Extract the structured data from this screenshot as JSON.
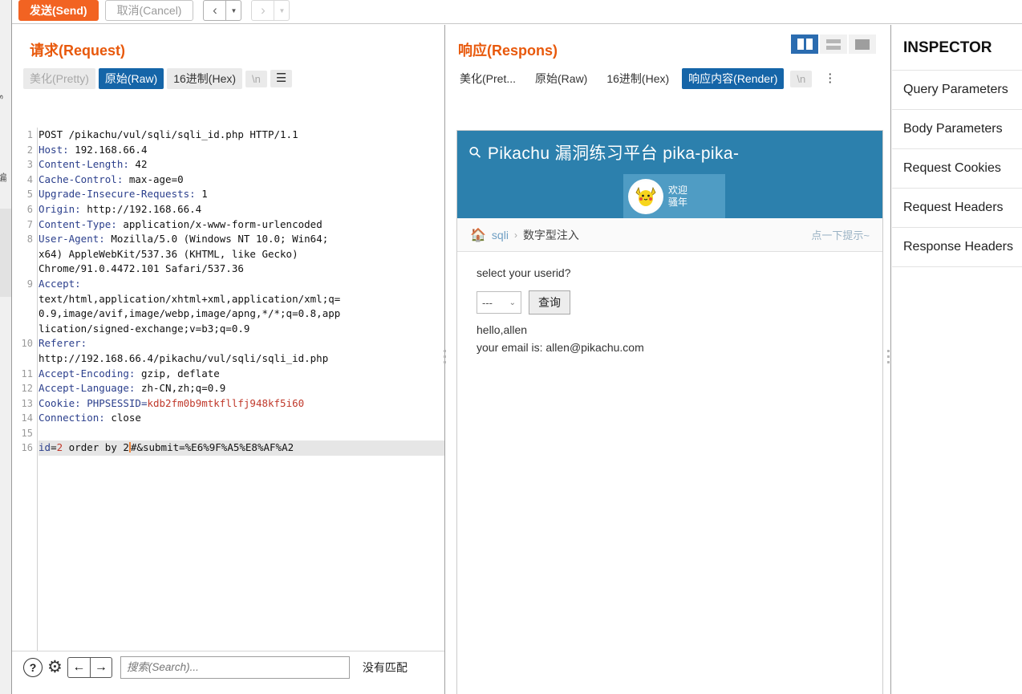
{
  "toolbar": {
    "send_label": "发送(Send)",
    "cancel_label": "取消(Cancel)",
    "prev_icon": "‹",
    "prev_caret": "▼",
    "next_icon": "›",
    "next_caret": "▼"
  },
  "request": {
    "title": "请求(Request)",
    "tabs": [
      {
        "label": "美化(Pretty)",
        "state": "muted"
      },
      {
        "label": "原始(Raw)",
        "state": "active"
      },
      {
        "label": "16进制(Hex)",
        "state": "normal"
      }
    ],
    "newline_label": "\\n",
    "menu_icon": "☰",
    "lines": [
      {
        "n": "1",
        "type": "plain",
        "text": "POST /pikachu/vul/sqli/sqli_id.php HTTP/1.1"
      },
      {
        "n": "2",
        "type": "hdr",
        "name": "Host:",
        "value": " 192.168.66.4"
      },
      {
        "n": "3",
        "type": "hdr",
        "name": "Content-Length:",
        "value": " 42"
      },
      {
        "n": "4",
        "type": "hdr",
        "name": "Cache-Control:",
        "value": " max-age=0"
      },
      {
        "n": "5",
        "type": "hdr",
        "name": "Upgrade-Insecure-Requests:",
        "value": " 1"
      },
      {
        "n": "6",
        "type": "hdr",
        "name": "Origin:",
        "value": " http://192.168.66.4"
      },
      {
        "n": "7",
        "type": "hdr",
        "name": "Content-Type:",
        "value": " application/x-www-form-urlencoded"
      },
      {
        "n": "8",
        "type": "hdr",
        "name": "User-Agent:",
        "value": " Mozilla/5.0 (Windows NT 10.0; Win64;"
      },
      {
        "n": "",
        "type": "cont",
        "text": "x64) AppleWebKit/537.36 (KHTML, like Gecko)"
      },
      {
        "n": "",
        "type": "cont",
        "text": "Chrome/91.0.4472.101 Safari/537.36"
      },
      {
        "n": "9",
        "type": "hdr",
        "name": "Accept:",
        "value": ""
      },
      {
        "n": "",
        "type": "cont",
        "text": "text/html,application/xhtml+xml,application/xml;q="
      },
      {
        "n": "",
        "type": "cont",
        "text": "0.9,image/avif,image/webp,image/apng,*/*;q=0.8,app"
      },
      {
        "n": "",
        "type": "cont",
        "text": "lication/signed-exchange;v=b3;q=0.9"
      },
      {
        "n": "10",
        "type": "hdr",
        "name": "Referer:",
        "value": ""
      },
      {
        "n": "",
        "type": "cont",
        "text": "http://192.168.66.4/pikachu/vul/sqli/sqli_id.php"
      },
      {
        "n": "11",
        "type": "hdr",
        "name": "Accept-Encoding:",
        "value": " gzip, deflate"
      },
      {
        "n": "12",
        "type": "hdr",
        "name": "Accept-Language:",
        "value": " zh-CN,zh;q=0.9"
      },
      {
        "n": "13",
        "type": "cookie",
        "name": "Cookie:",
        "prefix": " PHPSESSID=",
        "value": "kdb2fm0b9mtkfllfj948kf5i60"
      },
      {
        "n": "14",
        "type": "hdr",
        "name": "Connection:",
        "value": " close"
      },
      {
        "n": "15",
        "type": "plain",
        "text": ""
      }
    ],
    "body_line": {
      "n": "16",
      "key": "id",
      "eq": "=",
      "value": "2",
      "rest_before_caret": " order by 2",
      "rest_after_caret": "#&submit=%E6%9F%A5%E8%AF%A2"
    },
    "search": {
      "help_icon": "?",
      "gear_icon": "⚙",
      "prev_icon": "←",
      "next_icon": "→",
      "placeholder": "搜索(Search)...",
      "value": "",
      "status": "没有匹配"
    }
  },
  "response": {
    "title": "响应(Respons)",
    "tabs": [
      {
        "label": "美化(Pret...",
        "state": "normal"
      },
      {
        "label": "原始(Raw)",
        "state": "normal"
      },
      {
        "label": "16进制(Hex)",
        "state": "normal"
      },
      {
        "label": "响应内容(Render)",
        "state": "active"
      }
    ],
    "newline_label": "\\n",
    "menu_icon": "⋮",
    "layout_toggles": [
      {
        "name": "split-vertical",
        "active": true
      },
      {
        "name": "split-horizontal",
        "active": false
      },
      {
        "name": "single-pane",
        "active": false
      }
    ],
    "render": {
      "banner_icon": "search-icon",
      "banner_title": "Pikachu 漏洞练习平台 pika-pika-",
      "avatar_icon": "pikachu-avatar",
      "welcome_line1": "欢迎",
      "welcome_line2": "骚年",
      "breadcrumb": {
        "home_icon": "🏠",
        "root": "sqli",
        "separator": "›",
        "current": "数字型注入",
        "hint": "点一下提示~"
      },
      "prompt": "select your userid?",
      "select_value": "---",
      "select_caret": "⌄",
      "submit_label": "查询",
      "result_line1": "hello,allen",
      "result_line2": "your email is: allen@pikachu.com"
    }
  },
  "inspector": {
    "title": "INSPECTOR",
    "rows": [
      {
        "label": "Query Parameters"
      },
      {
        "label": "Body Parameters"
      },
      {
        "label": "Request Cookies"
      },
      {
        "label": "Request Headers"
      },
      {
        "label": "Response Headers"
      }
    ]
  },
  "left_strip": {
    "label_top": "s",
    "label_mid": "编"
  }
}
